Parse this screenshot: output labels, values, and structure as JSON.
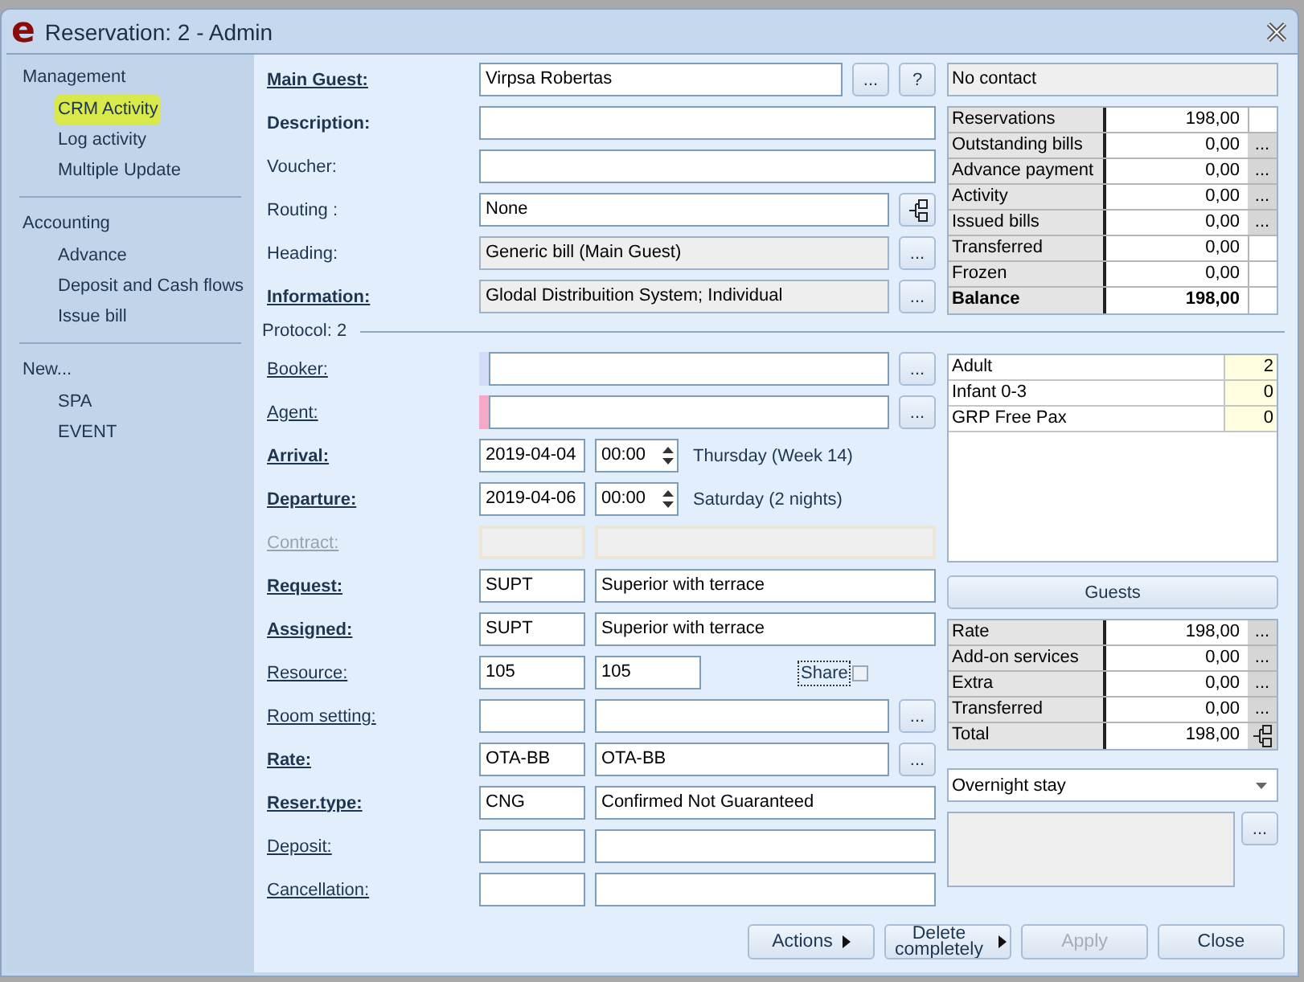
{
  "window": {
    "logo": "e",
    "title": "Reservation: 2 - Admin"
  },
  "sidebar": {
    "groups": [
      {
        "title": "Management",
        "items": [
          {
            "label": "CRM Activity",
            "highlighted": true
          },
          {
            "label": "Log activity",
            "highlighted": false
          },
          {
            "label": "Multiple Update",
            "highlighted": false
          }
        ]
      },
      {
        "title": "Accounting",
        "items": [
          {
            "label": "Advance",
            "highlighted": false
          },
          {
            "label": "Deposit and Cash flows",
            "highlighted": false
          },
          {
            "label": "Issue bill",
            "highlighted": false
          }
        ]
      },
      {
        "title": "New...",
        "items": [
          {
            "label": "SPA",
            "highlighted": false
          },
          {
            "label": "EVENT",
            "highlighted": false
          }
        ]
      }
    ]
  },
  "form": {
    "top_rows": [
      {
        "kind": "single",
        "label": {
          "text": "Main Guest:",
          "bold": true,
          "link": true,
          "disabled": false
        },
        "fields": [
          {
            "kind": "text",
            "value": "Virpsa Robertas"
          }
        ],
        "buttons": [
          {
            "kind": "dots",
            "label": "..."
          },
          {
            "kind": "dots",
            "label": "?"
          }
        ]
      },
      {
        "kind": "single",
        "label": {
          "text": "Description:",
          "bold": true,
          "link": false,
          "disabled": false
        },
        "fields": [
          {
            "kind": "text"
          }
        ],
        "buttons": []
      },
      {
        "kind": "single",
        "label": {
          "text": "Voucher:",
          "bold": false,
          "link": false,
          "disabled": false
        },
        "fields": [
          {
            "kind": "text"
          }
        ],
        "buttons": []
      },
      {
        "kind": "single",
        "label": {
          "text": "Routing :",
          "bold": false,
          "link": false,
          "disabled": false
        },
        "fields": [
          {
            "kind": "text",
            "value": "None"
          }
        ],
        "buttons": [
          {
            "kind": "tree"
          }
        ]
      },
      {
        "kind": "single",
        "label": {
          "text": "Heading:",
          "bold": false,
          "link": false,
          "disabled": false
        },
        "fields": [
          {
            "kind": "readonly",
            "value": "Generic bill (Main Guest)"
          }
        ],
        "buttons": [
          {
            "kind": "dots",
            "label": "..."
          }
        ]
      },
      {
        "kind": "single",
        "label": {
          "text": "Information:",
          "bold": true,
          "link": true,
          "disabled": false
        },
        "fields": [
          {
            "kind": "readonly",
            "value": "Glodal Distribuition System; Individual"
          }
        ],
        "buttons": [
          {
            "kind": "dots",
            "label": "..."
          }
        ]
      }
    ],
    "protocol": "Protocol: 2",
    "bottom_rows": [
      {
        "kind": "single",
        "label": {
          "text": "Booker:",
          "bold": false,
          "link": true,
          "disabled": false
        },
        "color": "#d4dcfa",
        "fields": [
          {
            "kind": "text"
          }
        ],
        "buttons": [
          {
            "kind": "dots",
            "label": "..."
          }
        ]
      },
      {
        "kind": "single",
        "label": {
          "text": "Agent:",
          "bold": false,
          "link": true,
          "disabled": false
        },
        "color": "#f6a9c6",
        "fields": [
          {
            "kind": "text"
          }
        ],
        "buttons": [
          {
            "kind": "dots",
            "label": "..."
          }
        ]
      },
      {
        "kind": "date",
        "label": {
          "text": "Arrival:",
          "bold": true,
          "link": true,
          "disabled": false
        },
        "fields": [
          {
            "kind": "text",
            "value": "2019-04-04"
          },
          {
            "kind": "time",
            "value": "00:00"
          }
        ],
        "day": "Thursday (Week 14)",
        "buttons": []
      },
      {
        "kind": "date",
        "label": {
          "text": "Departure:",
          "bold": true,
          "link": true,
          "disabled": false
        },
        "fields": [
          {
            "kind": "text",
            "value": "2019-04-06"
          },
          {
            "kind": "time",
            "value": "00:00"
          }
        ],
        "day": "Saturday (2 nights)",
        "buttons": []
      },
      {
        "kind": "pair",
        "label": {
          "text": "Contract:",
          "bold": false,
          "link": true,
          "disabled": true
        },
        "fields": [
          {
            "kind": "disabled"
          },
          {
            "kind": "disabled"
          }
        ],
        "buttons": []
      },
      {
        "kind": "pair",
        "label": {
          "text": "Request:",
          "bold": true,
          "link": true,
          "disabled": false
        },
        "fields": [
          {
            "kind": "text",
            "value": "SUPT"
          },
          {
            "kind": "text",
            "value": "Superior with terrace"
          }
        ],
        "buttons": []
      },
      {
        "kind": "pair",
        "label": {
          "text": "Assigned:",
          "bold": true,
          "link": true,
          "disabled": false
        },
        "fields": [
          {
            "kind": "text",
            "value": "SUPT"
          },
          {
            "kind": "text",
            "value": "Superior with terrace"
          }
        ],
        "buttons": []
      },
      {
        "kind": "resource",
        "label": {
          "text": "Resource:",
          "bold": false,
          "link": true,
          "disabled": false
        },
        "fields": [
          {
            "kind": "text",
            "value": "105"
          },
          {
            "kind": "text",
            "value": "105"
          }
        ],
        "share": {
          "label": "Share",
          "checked": false
        },
        "buttons": []
      },
      {
        "kind": "pair",
        "label": {
          "text": "Room setting:",
          "bold": false,
          "link": true,
          "disabled": false
        },
        "fields": [
          {
            "kind": "text"
          },
          {
            "kind": "text"
          }
        ],
        "buttons": [
          {
            "kind": "dots",
            "label": "..."
          }
        ]
      },
      {
        "kind": "pair",
        "label": {
          "text": "Rate:",
          "bold": true,
          "link": true,
          "disabled": false
        },
        "fields": [
          {
            "kind": "text",
            "value": "OTA-BB"
          },
          {
            "kind": "text",
            "value": "OTA-BB"
          }
        ],
        "buttons": [
          {
            "kind": "dots",
            "label": "..."
          }
        ]
      },
      {
        "kind": "pair",
        "label": {
          "text": "Reser.type:",
          "bold": true,
          "link": true,
          "disabled": false
        },
        "fields": [
          {
            "kind": "text",
            "value": "CNG"
          },
          {
            "kind": "text",
            "value": "Confirmed Not Guaranteed"
          }
        ],
        "buttons": []
      },
      {
        "kind": "pair",
        "label": {
          "text": "Deposit:",
          "bold": false,
          "link": true,
          "disabled": false
        },
        "fields": [
          {
            "kind": "text"
          },
          {
            "kind": "text"
          }
        ],
        "buttons": []
      },
      {
        "kind": "pair",
        "label": {
          "text": "Cancellation:",
          "bold": false,
          "link": true,
          "disabled": false
        },
        "fields": [
          {
            "kind": "text"
          },
          {
            "kind": "text"
          }
        ],
        "buttons": []
      }
    ]
  },
  "contact": "No contact",
  "summary": [
    {
      "label": "Reservations",
      "value": "198,00",
      "bold": false
    },
    {
      "label": "Outstanding bills",
      "value": "0,00",
      "bold": false,
      "button": {
        "kind": "dots",
        "label": "..."
      }
    },
    {
      "label": "Advance payment",
      "value": "0,00",
      "bold": false,
      "button": {
        "kind": "dots",
        "label": "..."
      }
    },
    {
      "label": "Activity",
      "value": "0,00",
      "bold": false,
      "button": {
        "kind": "dots",
        "label": "..."
      }
    },
    {
      "label": "Issued bills",
      "value": "0,00",
      "bold": false,
      "button": {
        "kind": "dots",
        "label": "..."
      }
    },
    {
      "label": "Transferred",
      "value": "0,00",
      "bold": false
    },
    {
      "label": "Frozen",
      "value": "0,00",
      "bold": false
    },
    {
      "label": "Balance",
      "value": "198,00",
      "bold": true
    }
  ],
  "pax": [
    {
      "label": "Adult",
      "count": "2"
    },
    {
      "label": "Infant 0-3",
      "count": "0"
    },
    {
      "label": "GRP Free Pax",
      "count": "0"
    }
  ],
  "guests_button": "Guests",
  "rates": [
    {
      "label": "Rate",
      "value": "198,00",
      "bold": false,
      "button": {
        "kind": "dots",
        "label": "..."
      }
    },
    {
      "label": "Add-on services",
      "value": "0,00",
      "bold": false,
      "button": {
        "kind": "dots",
        "label": "..."
      }
    },
    {
      "label": "Extra",
      "value": "0,00",
      "bold": false,
      "button": {
        "kind": "dots",
        "label": "..."
      }
    },
    {
      "label": "Transferred",
      "value": "0,00",
      "bold": false,
      "button": {
        "kind": "dots",
        "label": "..."
      }
    },
    {
      "label": "Total",
      "value": "198,00",
      "bold": false,
      "button": {
        "kind": "tree"
      }
    }
  ],
  "stay_type": "Overnight stay",
  "notes_button": "...",
  "footer_buttons": [
    {
      "label": "Actions",
      "arrow": true,
      "disabled": false
    },
    {
      "label": "Delete completely",
      "arrow": true,
      "disabled": false
    },
    {
      "label": "Apply",
      "arrow": false,
      "disabled": true
    },
    {
      "label": "Close",
      "arrow": false,
      "disabled": false
    }
  ]
}
